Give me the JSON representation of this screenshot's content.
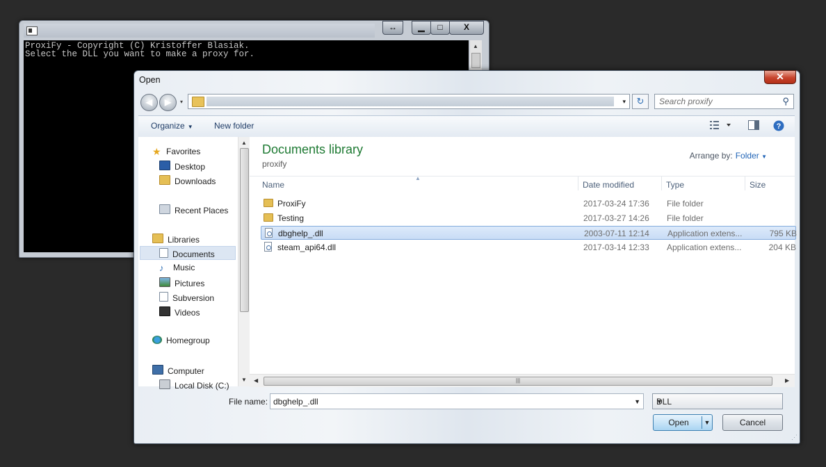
{
  "console": {
    "lines": "ProxiFy - Copyright (C) Kristoffer Blasiak.\nSelect the DLL you want to make a proxy for.",
    "buttons": {
      "resize": "↔",
      "minimize": "▁",
      "maximize": "□",
      "close": "X"
    }
  },
  "dialog": {
    "title": "Open",
    "close_glyph": "✕",
    "nav": {
      "back": "◀",
      "forward": "▶",
      "history": "▾",
      "refresh": "↻",
      "dropdown": "▾"
    },
    "search": {
      "placeholder": "Search proxify",
      "icon": "search-icon"
    },
    "toolbar": {
      "organize": "Organize",
      "new_folder": "New folder"
    },
    "navigation": {
      "favorites_header": "Favorites",
      "favorites": [
        "Desktop",
        "Downloads",
        "Recent Places"
      ],
      "libraries_header": "Libraries",
      "libraries": [
        "Documents",
        "Music",
        "Pictures",
        "Subversion",
        "Videos"
      ],
      "selected": "Documents",
      "homegroup": "Homegroup",
      "computer_header": "Computer",
      "computer": [
        "Local Disk (C:)"
      ]
    },
    "library": {
      "title": "Documents library",
      "subtitle": "proxify",
      "arrange_label": "Arrange by:",
      "arrange_value": "Folder"
    },
    "columns": [
      "Name",
      "Date modified",
      "Type",
      "Size"
    ],
    "files": [
      {
        "name": "ProxiFy",
        "date": "2017-03-24 17:36",
        "type": "File folder",
        "size": "",
        "kind": "folder"
      },
      {
        "name": "Testing",
        "date": "2017-03-27 14:26",
        "type": "File folder",
        "size": "",
        "kind": "folder"
      },
      {
        "name": "dbghelp_.dll",
        "date": "2003-07-11 12:14",
        "type": "Application extens...",
        "size": "795 KB",
        "kind": "dll"
      },
      {
        "name": "steam_api64.dll",
        "date": "2017-03-14 12:33",
        "type": "Application extens...",
        "size": "204 KB",
        "kind": "dll"
      }
    ],
    "selected_file": "dbghelp_.dll",
    "file_name_label": "File name:",
    "file_name_value": "dbghelp_.dll",
    "file_type": "DLL",
    "open_button": "Open",
    "cancel_button": "Cancel"
  },
  "colors": {
    "accent_green": "#1e7a33",
    "link_blue": "#1f63b6",
    "selection": "#c8dcf6"
  }
}
